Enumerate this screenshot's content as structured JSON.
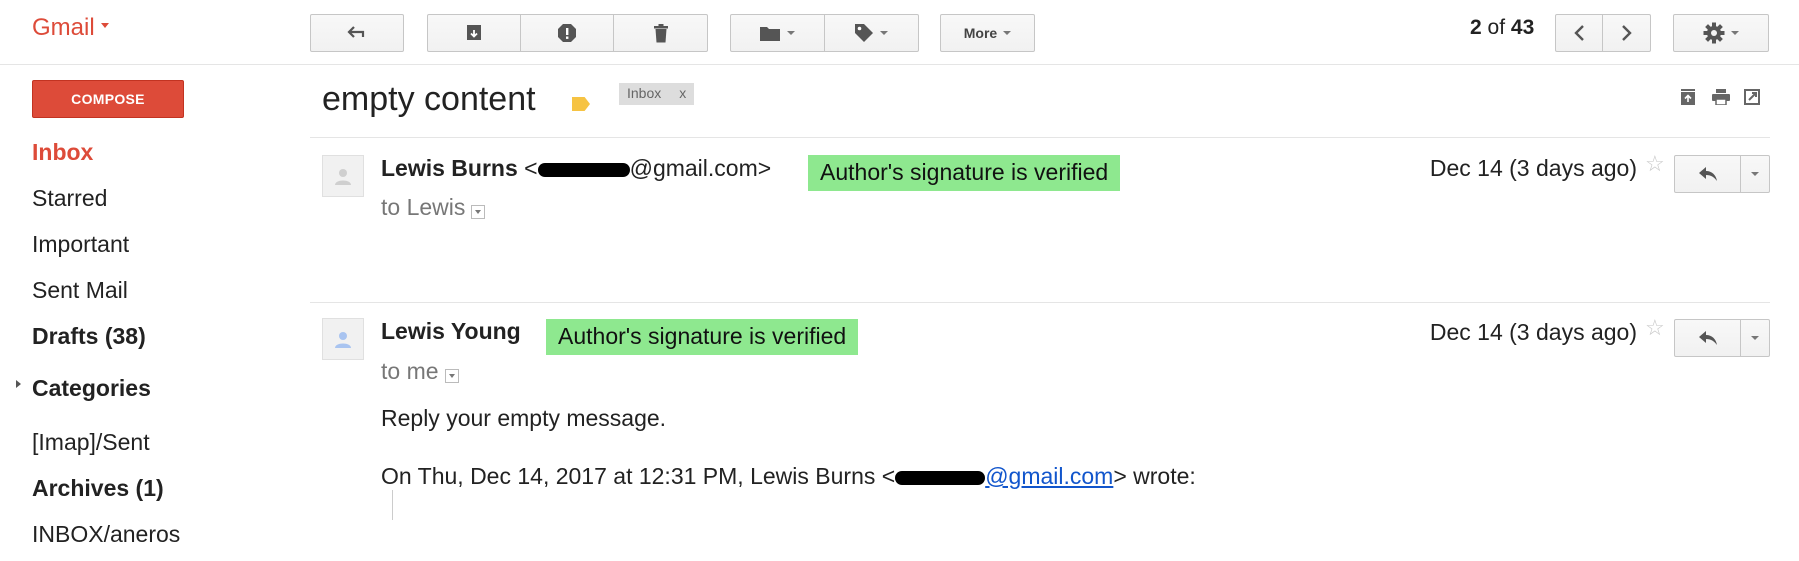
{
  "app": {
    "logo": "Gmail"
  },
  "toolbar": {
    "more_label": "More",
    "pager": {
      "current": "2",
      "of": "of",
      "total": "43"
    }
  },
  "sidebar": {
    "compose_label": "COMPOSE",
    "items": [
      {
        "label": "Inbox",
        "active": true
      },
      {
        "label": "Starred"
      },
      {
        "label": "Important"
      },
      {
        "label": "Sent Mail"
      },
      {
        "label": "Drafts (38)",
        "bold": true
      },
      {
        "label": "Categories",
        "bold": true
      },
      {
        "label": "[Imap]/Sent"
      },
      {
        "label": "Archives (1)",
        "bold": true
      },
      {
        "label": "INBOX/aneros"
      }
    ]
  },
  "thread": {
    "subject": "empty content",
    "label_chip": {
      "label": "Inbox",
      "close": "x"
    },
    "messages": [
      {
        "sender_name": "Lewis Burns",
        "email_open": "<",
        "email_visible": "@gmail.com>",
        "verified": "Author's signature is verified",
        "to": "to Lewis",
        "date": "Dec 14 (3 days ago)"
      },
      {
        "sender_name": "Lewis Young",
        "verified": "Author's signature is verified",
        "to": "to me",
        "date": "Dec 14 (3 days ago)",
        "body": "Reply your empty message.",
        "quote_prefix": "On Thu, Dec 14, 2017 at 12:31 PM, Lewis Burns <",
        "quote_link": "@gmail.com",
        "quote_suffix": "> wrote:"
      }
    ]
  },
  "colors": {
    "brand_red": "#dd4b39",
    "verified_bg": "#8ee88f",
    "link": "#1155cc",
    "label_tag": "#f6c343"
  },
  "icons": [
    "caret-down-icon",
    "reply-icon",
    "archive-icon",
    "report-spam-icon",
    "delete-icon",
    "folder-icon",
    "label-icon",
    "chevron-left-icon",
    "chevron-right-icon",
    "gear-icon",
    "collapse-all-icon",
    "print-icon",
    "new-window-icon",
    "person-icon",
    "star-icon"
  ]
}
